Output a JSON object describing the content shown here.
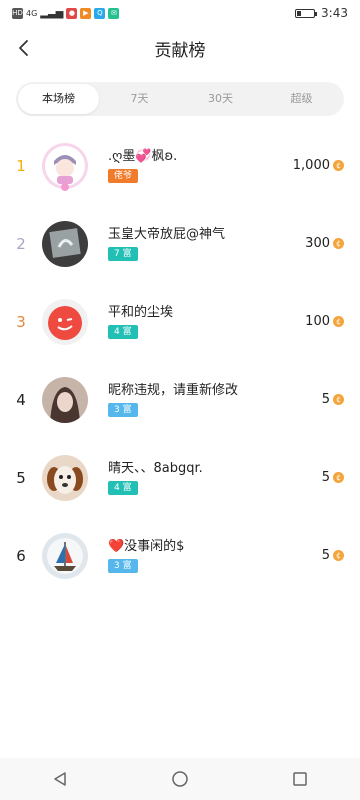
{
  "statusbar": {
    "time": "3:43",
    "net": "4G"
  },
  "header": {
    "title": "贡献榜"
  },
  "tabs": [
    {
      "label": "本场榜",
      "active": true
    },
    {
      "label": "7天",
      "active": false
    },
    {
      "label": "30天",
      "active": false
    },
    {
      "label": "超级",
      "active": false
    }
  ],
  "rows": [
    {
      "rank": "1",
      "name": ".ღ墨💞枫ʚ.",
      "badge": "佬爷",
      "score": "1,000"
    },
    {
      "rank": "2",
      "name": "玉皇大帝放屁@神气",
      "badge": "7 富",
      "score": "300"
    },
    {
      "rank": "3",
      "name": "平和的尘埃",
      "badge": "4 富",
      "score": "100"
    },
    {
      "rank": "4",
      "name": "昵称违规，请重新修改",
      "badge": "3 富",
      "score": "5"
    },
    {
      "rank": "5",
      "name": "晴天、、8abgqr.",
      "badge": "4 富",
      "score": "5"
    },
    {
      "rank": "6",
      "name": "❤️没事闲的$",
      "badge": "3 富",
      "score": "5"
    }
  ],
  "colors": {
    "rank1": "#f2b100",
    "rank2": "#a7a9c3",
    "rank3": "#e3873b",
    "rankDefault": "#222222",
    "badgeTeal": "#22bfb4",
    "badgeBlue": "#55b7ec",
    "badgeOrange": "#f07b2b",
    "coin": "#f3a53b"
  },
  "icons": {
    "back": "chevron-left-icon",
    "coin": "coin-icon",
    "navBack": "triangle-back-icon",
    "navHome": "circle-home-icon",
    "navRecent": "square-recent-icon"
  }
}
